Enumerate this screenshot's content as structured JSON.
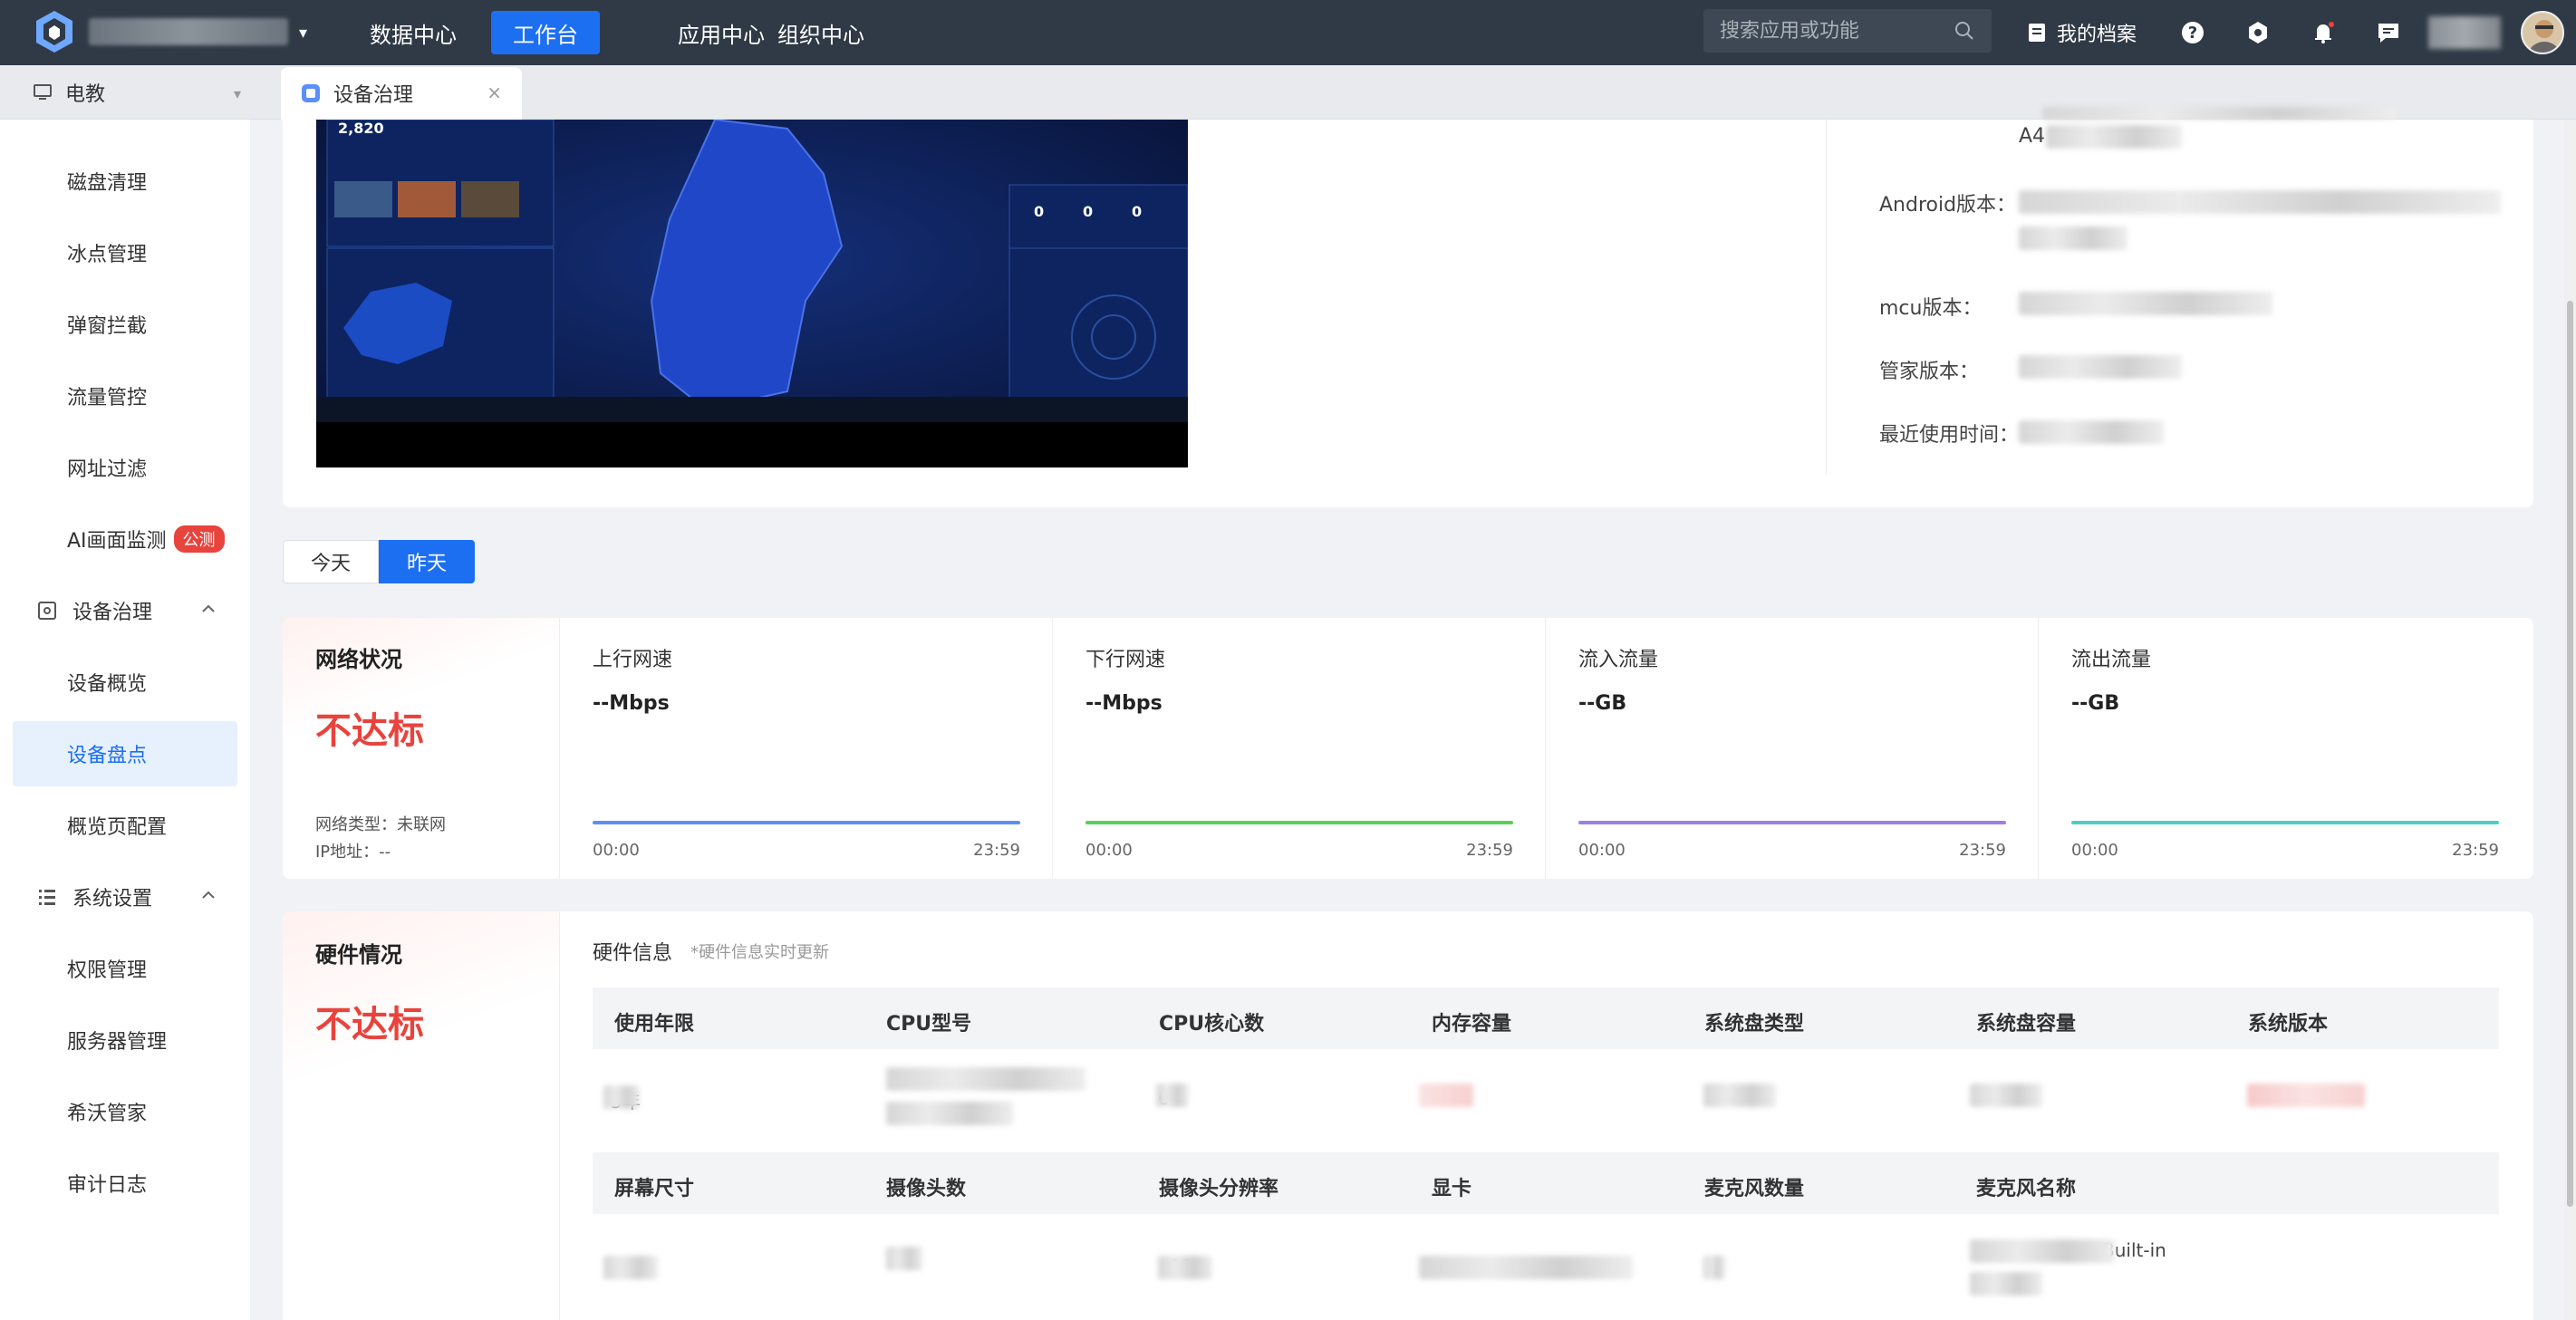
{
  "topbar": {
    "nav": [
      "数据中心",
      "工作台",
      "应用中心",
      "组织中心"
    ],
    "active_nav": "工作台",
    "search_placeholder": "搜索应用或功能",
    "my_file": "我的档案"
  },
  "tabbar": {
    "project": "电教",
    "tab": "设备治理"
  },
  "sidebar": {
    "items_top": [
      "磁盘清理",
      "冰点管理",
      "弹窗拦截",
      "流量管控",
      "网址过滤",
      "AI画面监测"
    ],
    "beta_badge": "公测",
    "group_device": "设备治理",
    "device_items": [
      "设备概览",
      "设备盘点",
      "概览页配置"
    ],
    "active_item": "设备盘点",
    "group_system": "系统设置",
    "system_items": [
      "权限管理",
      "服务器管理",
      "希沃管家",
      "审计日志"
    ]
  },
  "device_info": {
    "partial_value": "A4",
    "android_label": "Android版本：",
    "mcu_label": "mcu版本：",
    "manager_label": "管家版本：",
    "last_used_label": "最近使用时间：",
    "screen_number": "2,820",
    "screen_counts": [
      "0",
      "0",
      "0"
    ]
  },
  "day_toggle": {
    "today": "今天",
    "yesterday": "昨天",
    "selected": "昨天"
  },
  "network": {
    "title": "网络状况",
    "status": "不达标",
    "type": "网络类型：未联网",
    "ip": "IP地址：--",
    "metrics": [
      {
        "title": "上行网速",
        "value": "--Mbps",
        "color": "#5b8ff9"
      },
      {
        "title": "下行网速",
        "value": "--Mbps",
        "color": "#5ad05a"
      },
      {
        "title": "流入流量",
        "value": "--GB",
        "color": "#9b7fe6"
      },
      {
        "title": "流出流量",
        "value": "--GB",
        "color": "#4ecdc4"
      }
    ],
    "time_start": "00:00",
    "time_end": "23:59"
  },
  "hardware": {
    "title": "硬件情况",
    "status": "不达标",
    "sub_title": "硬件信息",
    "note": "*硬件信息实时更新",
    "head1": [
      "使用年限",
      "CPU型号",
      "CPU核心数",
      "内存容量",
      "系统盘类型",
      "系统盘容量",
      "系统版本"
    ],
    "head2": [
      "屏幕尺寸",
      "摄像头数",
      "摄像头分辨率",
      "显卡",
      "麦克风数量",
      "麦克风名称"
    ],
    "row1_partial": {
      "years": "5年",
      "cores": "6"
    },
    "row2_partial": {
      "resolution": "08",
      "mic_name": "Built-in"
    }
  }
}
